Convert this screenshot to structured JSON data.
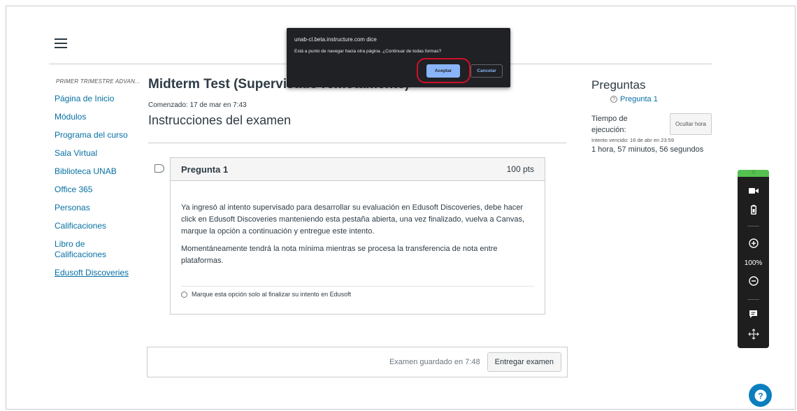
{
  "sidebar": {
    "course_label": "PRIMER TRIMESTRE ADVAN...",
    "items": [
      {
        "label": "Página de Inicio"
      },
      {
        "label": "Módulos"
      },
      {
        "label": "Programa del curso"
      },
      {
        "label": "Sala Virtual"
      },
      {
        "label": "Biblioteca UNAB"
      },
      {
        "label": "Office 365"
      },
      {
        "label": "Personas"
      },
      {
        "label": "Calificaciones"
      },
      {
        "label": "Libro de Calificaciones"
      },
      {
        "label": "Edusoft Discoveries"
      }
    ]
  },
  "quiz": {
    "title": "Midterm Test (Supervisado remotamente)",
    "started": "Comenzado: 17 de mar en 7:43",
    "instructions_heading": "Instrucciones del examen"
  },
  "question": {
    "name": "Pregunta 1",
    "points": "100 pts",
    "paragraph1": "Ya ingresó al intento supervisado para desarrollar su evaluación en Edusoft Discoveries, debe hacer click en Edusoft Discoveries manteniendo esta pestaña abierta, una vez finalizado, vuelva a Canvas, marque la opción a continuación y entregue este intento.",
    "paragraph2": "Momentáneamente tendrá la nota mínima mientras se procesa la transferencia de nota entre plataformas.",
    "answer": "Marque esta opción solo al finalizar su intento en Edusoft"
  },
  "submit": {
    "saved": "Examen guardado en 7:48",
    "button": "Entregar examen"
  },
  "right_panel": {
    "title": "Preguntas",
    "question_link": "Pregunta 1",
    "time_label": "Tiempo de ejecución:",
    "hide_button": "Ocultar hora",
    "due": "Intento vencido: 16 de abr en 23:59",
    "remaining": "1 hora, 57 minutos, 56 segundos"
  },
  "proctor": {
    "zoom": "100%",
    "icons": [
      "video-icon",
      "battery-icon",
      "zoom-in-icon",
      "zoom-out-icon",
      "chat-icon",
      "move-icon"
    ]
  },
  "dialog": {
    "title": "unab-cl.beta.instructure.com dice",
    "message": "Está a punto de navegar hacia otra página. ¿Continuar de todas formas?",
    "ok": "Aceptar",
    "cancel": "Cancelar"
  },
  "colors": {
    "link": "#0770a3",
    "dialog_bg": "#202124",
    "dialog_button": "#8ab4f8",
    "highlight": "#d0102a",
    "proctor_bg": "#1e1e1e",
    "proctor_grip": "#55c150",
    "help": "#0b7fbd"
  }
}
